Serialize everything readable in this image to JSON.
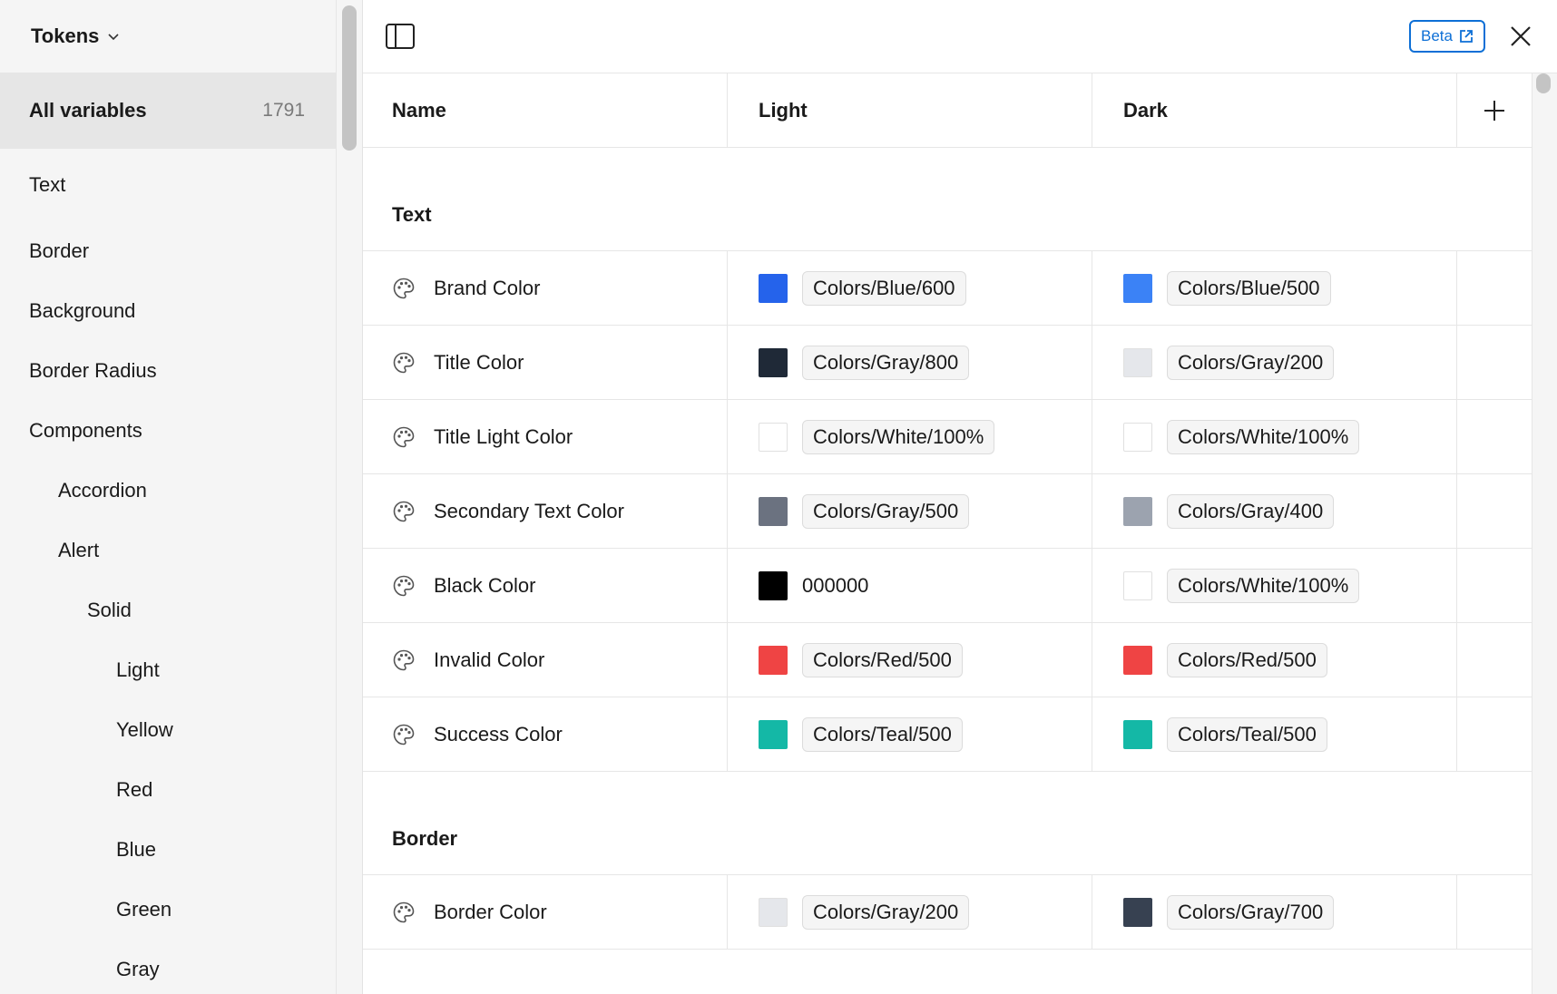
{
  "sidebar": {
    "title": "Tokens",
    "all_variables": {
      "label": "All variables",
      "count": "1791"
    },
    "items": [
      {
        "label": "Text",
        "indent": 0
      },
      {
        "label": "Border",
        "indent": 0
      },
      {
        "label": "Background",
        "indent": 0
      },
      {
        "label": "Border Radius",
        "indent": 0
      },
      {
        "label": "Components",
        "indent": 0
      },
      {
        "label": "Accordion",
        "indent": 1
      },
      {
        "label": "Alert",
        "indent": 1
      },
      {
        "label": "Solid",
        "indent": 2
      },
      {
        "label": "Light",
        "indent": 3
      },
      {
        "label": "Yellow",
        "indent": 3
      },
      {
        "label": "Red",
        "indent": 3
      },
      {
        "label": "Blue",
        "indent": 3
      },
      {
        "label": "Green",
        "indent": 3
      },
      {
        "label": "Gray",
        "indent": 3
      }
    ]
  },
  "topbar": {
    "beta_label": "Beta"
  },
  "table": {
    "columns": {
      "name": "Name",
      "light": "Light",
      "dark": "Dark"
    },
    "groups": [
      {
        "title": "Text",
        "rows": [
          {
            "name": "Brand Color",
            "light": {
              "color": "#2563eb",
              "value": "Colors/Blue/600",
              "chip": true
            },
            "dark": {
              "color": "#3b82f6",
              "value": "Colors/Blue/500",
              "chip": true
            }
          },
          {
            "name": "Title Color",
            "light": {
              "color": "#1f2937",
              "value": "Colors/Gray/800",
              "chip": true
            },
            "dark": {
              "color": "#e5e7eb",
              "value": "Colors/Gray/200",
              "chip": true
            }
          },
          {
            "name": "Title Light Color",
            "light": {
              "color": "#ffffff",
              "value": "Colors/White/100%",
              "chip": true
            },
            "dark": {
              "color": "#ffffff",
              "value": "Colors/White/100%",
              "chip": true
            }
          },
          {
            "name": "Secondary Text Color",
            "light": {
              "color": "#6b7280",
              "value": "Colors/Gray/500",
              "chip": true
            },
            "dark": {
              "color": "#9ca3af",
              "value": "Colors/Gray/400",
              "chip": true
            }
          },
          {
            "name": "Black Color",
            "light": {
              "color": "#000000",
              "value": "000000",
              "chip": false
            },
            "dark": {
              "color": "#ffffff",
              "value": "Colors/White/100%",
              "chip": true
            }
          },
          {
            "name": "Invalid Color",
            "light": {
              "color": "#ef4444",
              "value": "Colors/Red/500",
              "chip": true
            },
            "dark": {
              "color": "#ef4444",
              "value": "Colors/Red/500",
              "chip": true
            }
          },
          {
            "name": "Success Color",
            "light": {
              "color": "#14b8a6",
              "value": "Colors/Teal/500",
              "chip": true
            },
            "dark": {
              "color": "#14b8a6",
              "value": "Colors/Teal/500",
              "chip": true
            }
          }
        ]
      },
      {
        "title": "Border",
        "rows": [
          {
            "name": "Border Color",
            "light": {
              "color": "#e5e7eb",
              "value": "Colors/Gray/200",
              "chip": true
            },
            "dark": {
              "color": "#374151",
              "value": "Colors/Gray/700",
              "chip": true
            }
          }
        ]
      }
    ]
  }
}
